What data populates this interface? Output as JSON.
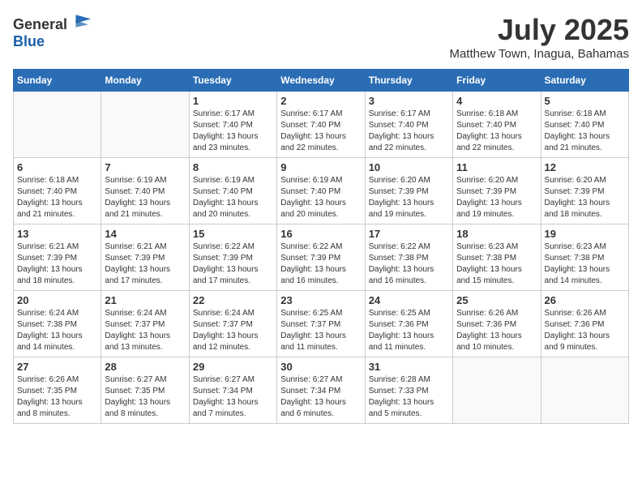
{
  "logo": {
    "general": "General",
    "blue": "Blue"
  },
  "title": "July 2025",
  "subtitle": "Matthew Town, Inagua, Bahamas",
  "days_of_week": [
    "Sunday",
    "Monday",
    "Tuesday",
    "Wednesday",
    "Thursday",
    "Friday",
    "Saturday"
  ],
  "weeks": [
    [
      {
        "day": "",
        "info": ""
      },
      {
        "day": "",
        "info": ""
      },
      {
        "day": "1",
        "info": "Sunrise: 6:17 AM\nSunset: 7:40 PM\nDaylight: 13 hours and 23 minutes."
      },
      {
        "day": "2",
        "info": "Sunrise: 6:17 AM\nSunset: 7:40 PM\nDaylight: 13 hours and 22 minutes."
      },
      {
        "day": "3",
        "info": "Sunrise: 6:17 AM\nSunset: 7:40 PM\nDaylight: 13 hours and 22 minutes."
      },
      {
        "day": "4",
        "info": "Sunrise: 6:18 AM\nSunset: 7:40 PM\nDaylight: 13 hours and 22 minutes."
      },
      {
        "day": "5",
        "info": "Sunrise: 6:18 AM\nSunset: 7:40 PM\nDaylight: 13 hours and 21 minutes."
      }
    ],
    [
      {
        "day": "6",
        "info": "Sunrise: 6:18 AM\nSunset: 7:40 PM\nDaylight: 13 hours and 21 minutes."
      },
      {
        "day": "7",
        "info": "Sunrise: 6:19 AM\nSunset: 7:40 PM\nDaylight: 13 hours and 21 minutes."
      },
      {
        "day": "8",
        "info": "Sunrise: 6:19 AM\nSunset: 7:40 PM\nDaylight: 13 hours and 20 minutes."
      },
      {
        "day": "9",
        "info": "Sunrise: 6:19 AM\nSunset: 7:40 PM\nDaylight: 13 hours and 20 minutes."
      },
      {
        "day": "10",
        "info": "Sunrise: 6:20 AM\nSunset: 7:39 PM\nDaylight: 13 hours and 19 minutes."
      },
      {
        "day": "11",
        "info": "Sunrise: 6:20 AM\nSunset: 7:39 PM\nDaylight: 13 hours and 19 minutes."
      },
      {
        "day": "12",
        "info": "Sunrise: 6:20 AM\nSunset: 7:39 PM\nDaylight: 13 hours and 18 minutes."
      }
    ],
    [
      {
        "day": "13",
        "info": "Sunrise: 6:21 AM\nSunset: 7:39 PM\nDaylight: 13 hours and 18 minutes."
      },
      {
        "day": "14",
        "info": "Sunrise: 6:21 AM\nSunset: 7:39 PM\nDaylight: 13 hours and 17 minutes."
      },
      {
        "day": "15",
        "info": "Sunrise: 6:22 AM\nSunset: 7:39 PM\nDaylight: 13 hours and 17 minutes."
      },
      {
        "day": "16",
        "info": "Sunrise: 6:22 AM\nSunset: 7:39 PM\nDaylight: 13 hours and 16 minutes."
      },
      {
        "day": "17",
        "info": "Sunrise: 6:22 AM\nSunset: 7:38 PM\nDaylight: 13 hours and 16 minutes."
      },
      {
        "day": "18",
        "info": "Sunrise: 6:23 AM\nSunset: 7:38 PM\nDaylight: 13 hours and 15 minutes."
      },
      {
        "day": "19",
        "info": "Sunrise: 6:23 AM\nSunset: 7:38 PM\nDaylight: 13 hours and 14 minutes."
      }
    ],
    [
      {
        "day": "20",
        "info": "Sunrise: 6:24 AM\nSunset: 7:38 PM\nDaylight: 13 hours and 14 minutes."
      },
      {
        "day": "21",
        "info": "Sunrise: 6:24 AM\nSunset: 7:37 PM\nDaylight: 13 hours and 13 minutes."
      },
      {
        "day": "22",
        "info": "Sunrise: 6:24 AM\nSunset: 7:37 PM\nDaylight: 13 hours and 12 minutes."
      },
      {
        "day": "23",
        "info": "Sunrise: 6:25 AM\nSunset: 7:37 PM\nDaylight: 13 hours and 11 minutes."
      },
      {
        "day": "24",
        "info": "Sunrise: 6:25 AM\nSunset: 7:36 PM\nDaylight: 13 hours and 11 minutes."
      },
      {
        "day": "25",
        "info": "Sunrise: 6:26 AM\nSunset: 7:36 PM\nDaylight: 13 hours and 10 minutes."
      },
      {
        "day": "26",
        "info": "Sunrise: 6:26 AM\nSunset: 7:36 PM\nDaylight: 13 hours and 9 minutes."
      }
    ],
    [
      {
        "day": "27",
        "info": "Sunrise: 6:26 AM\nSunset: 7:35 PM\nDaylight: 13 hours and 8 minutes."
      },
      {
        "day": "28",
        "info": "Sunrise: 6:27 AM\nSunset: 7:35 PM\nDaylight: 13 hours and 8 minutes."
      },
      {
        "day": "29",
        "info": "Sunrise: 6:27 AM\nSunset: 7:34 PM\nDaylight: 13 hours and 7 minutes."
      },
      {
        "day": "30",
        "info": "Sunrise: 6:27 AM\nSunset: 7:34 PM\nDaylight: 13 hours and 6 minutes."
      },
      {
        "day": "31",
        "info": "Sunrise: 6:28 AM\nSunset: 7:33 PM\nDaylight: 13 hours and 5 minutes."
      },
      {
        "day": "",
        "info": ""
      },
      {
        "day": "",
        "info": ""
      }
    ]
  ]
}
